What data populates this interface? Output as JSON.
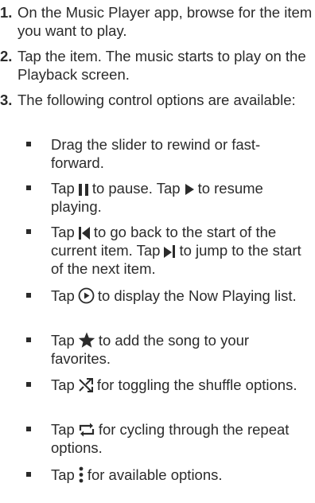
{
  "steps": [
    {
      "number": "1.",
      "text": "On the Music Player app, browse for the item you want to play."
    },
    {
      "number": "2.",
      "text": "Tap the item. The music starts to play on the Playback screen."
    },
    {
      "number": "3.",
      "text": "The following control options are available:"
    }
  ],
  "bullets": {
    "slider": "Drag the slider to rewind or fast-forward.",
    "pause": {
      "tap1": "Tap",
      "mid": "to pause. Tap",
      "end": "to resume playing."
    },
    "prev_next": {
      "tap1": "Tap",
      "mid": "to go back to the start of the current item. Tap",
      "end": "to jump to the start of the next item."
    },
    "now_playing": {
      "tap": "Tap",
      "end": "to display the Now Playing list."
    },
    "favorite": {
      "tap": "Tap",
      "end": "to add the song to your favorites."
    },
    "shuffle": {
      "tap": "Tap",
      "end": "for toggling the shuffle options."
    },
    "repeat": {
      "tap": "Tap",
      "end": "for cycling through the repeat options."
    },
    "more": {
      "tap": "Tap",
      "end": "for available options."
    }
  },
  "icons": {
    "pause": "pause-icon",
    "play": "play-icon",
    "previous": "skip-previous-icon",
    "next": "skip-next-icon",
    "now_playing": "play-circle-icon",
    "favorite": "star-icon",
    "shuffle": "shuffle-icon",
    "repeat": "repeat-icon",
    "more": "more-vertical-icon"
  },
  "colors": {
    "text": "#2b2b2b"
  }
}
